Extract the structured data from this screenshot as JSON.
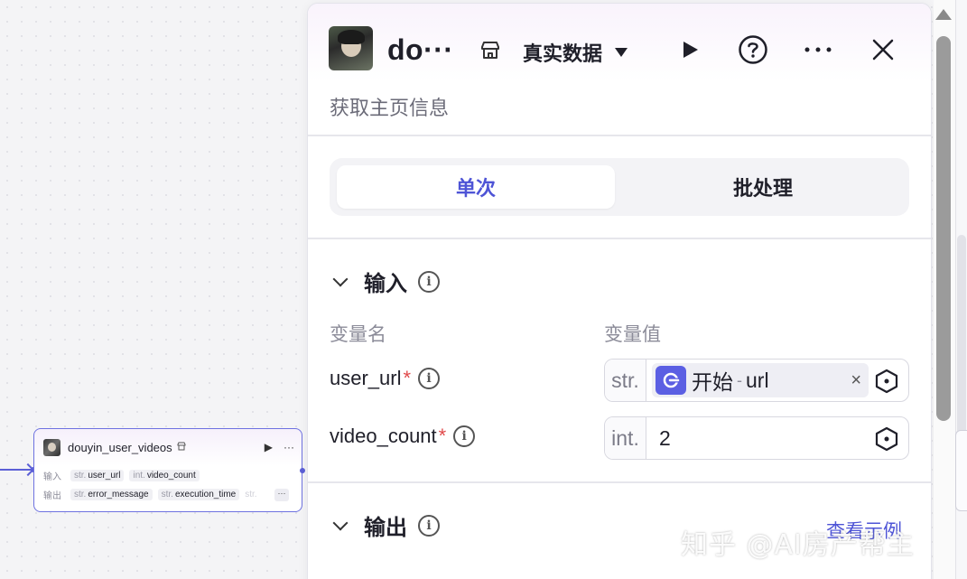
{
  "canvas": {
    "node": {
      "title": "douyin_user_videos",
      "store_icon": "store-icon",
      "run_icon": "▶",
      "more_icon": "···",
      "input_label": "输入",
      "output_label": "输出",
      "inputs": [
        {
          "type": "str.",
          "name": "user_url"
        },
        {
          "type": "int.",
          "name": "video_count"
        }
      ],
      "outputs": [
        {
          "type": "str.",
          "name": "error_message"
        },
        {
          "type": "str.",
          "name": "execution_time"
        },
        {
          "type": "str.",
          "name": ""
        }
      ],
      "overflow": "···"
    }
  },
  "panel": {
    "title": "do···",
    "env_label": "真实数据",
    "description": "获取主页信息",
    "tabs": [
      {
        "label": "单次",
        "active": true
      },
      {
        "label": "批处理",
        "active": false
      }
    ],
    "input_section": {
      "title": "输入",
      "col_name": "变量名",
      "col_value": "变量值",
      "params": [
        {
          "name": "user_url",
          "required": "*",
          "type": "str.",
          "ref_node": "开始",
          "ref_sep": "-",
          "ref_field": "url",
          "clear": "×"
        },
        {
          "name": "video_count",
          "required": "*",
          "type": "int.",
          "value": "2"
        }
      ]
    },
    "output_section": {
      "title": "输出",
      "example_link": "查看示例"
    }
  },
  "watermark": "知乎 @AI房产帮主",
  "colors": {
    "accent": "#4e54d6",
    "ref_icon_bg": "#5b5fe3",
    "required": "#e0494a",
    "node_border": "#6e72e0"
  }
}
